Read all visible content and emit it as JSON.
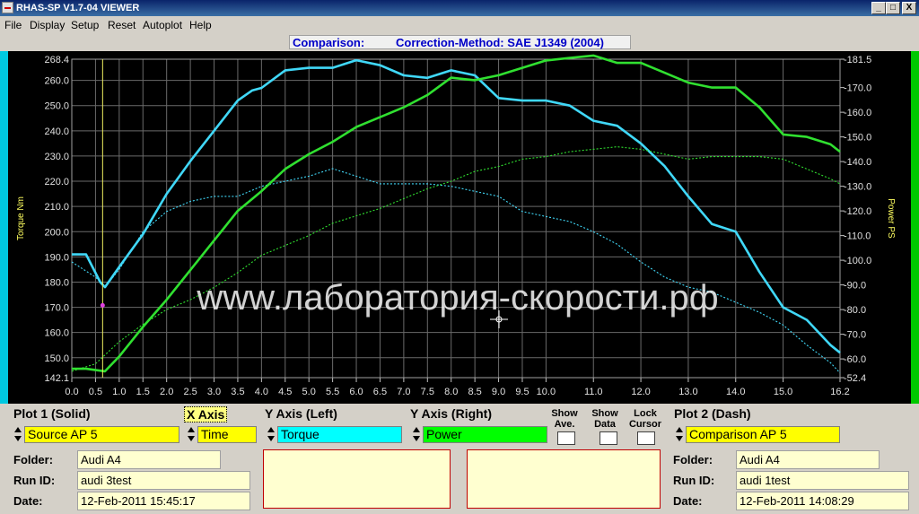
{
  "window": {
    "title": "RHAS-SP V1.7-04  VIEWER"
  },
  "window_buttons": [
    "_",
    "□",
    "X"
  ],
  "menu": [
    "File",
    "Display",
    "Setup",
    "Reset",
    "Autoplot",
    "Help"
  ],
  "status": {
    "label": "Comparison:",
    "method": "Correction-Method: SAE J1349 (2004)"
  },
  "watermark": "www.лаборатория-скорости.рф",
  "chart_data": {
    "type": "line",
    "xlim": [
      0,
      16.2
    ],
    "x_ticks": [
      "0.0",
      "0.5",
      "1.0",
      "1.5",
      "2.0",
      "2.5",
      "3.0",
      "3.5",
      "4.0",
      "4.5",
      "5.0",
      "5.5",
      "6.0",
      "6.5",
      "7.0",
      "7.5",
      "8.0",
      "8.5",
      "9.0",
      "9.5",
      "10.0",
      "11.0",
      "12.0",
      "13.0",
      "14.0",
      "15.0",
      "16.2"
    ],
    "ylabel_left": "Torque Nm",
    "ylim_left": [
      142.1,
      268.4
    ],
    "y_ticks_left": [
      "268.4",
      "260.0",
      "250.0",
      "240.0",
      "230.0",
      "220.0",
      "210.0",
      "200.0",
      "190.0",
      "180.0",
      "170.0",
      "160.0",
      "150.0",
      "142.1"
    ],
    "ylabel_right": "Power PS",
    "ylim_right": [
      52.4,
      181.5
    ],
    "y_ticks_right": [
      "181.5",
      "170.0",
      "160.0",
      "150.0",
      "140.0",
      "130.0",
      "120.0",
      "110.0",
      "100.0",
      "90.0",
      "80.0",
      "70.0",
      "60.0",
      "52.4"
    ],
    "cursor_x": 0.65,
    "series": [
      {
        "name": "Torque",
        "axis": "left",
        "style": "solid",
        "color": "#40d8f8",
        "x": [
          0,
          0.3,
          0.6,
          0.7,
          1.0,
          1.5,
          2.0,
          2.5,
          3.0,
          3.5,
          3.8,
          4.0,
          4.5,
          5.0,
          5.5,
          6.0,
          6.5,
          7.0,
          7.5,
          8.0,
          8.5,
          9.0,
          9.5,
          10.0,
          10.5,
          11.0,
          11.5,
          12.0,
          12.5,
          13.0,
          13.5,
          14.0,
          14.5,
          15.0,
          15.5,
          16.0,
          16.2
        ],
        "y": [
          191,
          191,
          180,
          178,
          186,
          199,
          215,
          228,
          240,
          252,
          256,
          257,
          264,
          265,
          265,
          268,
          266,
          262,
          261,
          264,
          262,
          253,
          252,
          252,
          250,
          244,
          242,
          235,
          226,
          214,
          203,
          200,
          184,
          170,
          165,
          155,
          152
        ]
      },
      {
        "name": "Torque (Comparison AP 5)",
        "axis": "left",
        "style": "dash",
        "color": "#40d8f8",
        "x": [
          0,
          0.5,
          0.7,
          1.0,
          1.5,
          2.0,
          2.5,
          3.0,
          3.5,
          4.0,
          4.5,
          5.0,
          5.5,
          6.0,
          6.5,
          7.0,
          7.5,
          8.0,
          8.5,
          9.0,
          9.5,
          10.0,
          10.5,
          11.0,
          11.5,
          12.0,
          12.5,
          13.0,
          13.5,
          14.0,
          14.5,
          15.0,
          15.5,
          16.0,
          16.2
        ],
        "y": [
          188,
          182,
          178,
          185,
          200,
          208,
          212,
          214,
          214,
          218,
          220,
          222,
          225,
          222,
          219,
          219,
          219,
          218,
          216,
          214,
          208,
          206,
          204,
          200,
          195,
          188,
          182,
          178,
          176,
          172,
          168,
          163,
          155,
          148,
          144
        ]
      },
      {
        "name": "Power",
        "axis": "right",
        "style": "solid",
        "color": "#30e030",
        "x": [
          0,
          0.3,
          0.7,
          1.0,
          1.5,
          2.0,
          2.5,
          3.0,
          3.5,
          4.0,
          4.5,
          5.0,
          5.5,
          6.0,
          6.5,
          7.0,
          7.5,
          8.0,
          8.5,
          9.0,
          9.5,
          10.0,
          10.5,
          11.0,
          11.5,
          12.0,
          12.5,
          13.0,
          13.5,
          14.0,
          14.5,
          15.0,
          15.5,
          16.0,
          16.2
        ],
        "y": [
          56,
          56,
          55,
          61,
          73,
          84,
          96,
          108,
          120,
          128,
          137,
          143,
          148,
          154,
          158,
          162,
          167,
          174,
          173,
          175,
          178,
          181,
          182,
          183,
          180,
          180,
          176,
          172,
          170,
          170,
          162,
          151,
          150,
          147,
          144
        ]
      },
      {
        "name": "Power (Comparison AP 5)",
        "axis": "right",
        "style": "dash",
        "color": "#30e030",
        "x": [
          0,
          0.5,
          1.0,
          1.5,
          2.0,
          2.5,
          3.0,
          3.5,
          4.0,
          4.5,
          5.0,
          5.5,
          6.0,
          6.5,
          7.0,
          7.5,
          8.0,
          8.5,
          9.0,
          9.5,
          10.0,
          10.5,
          11.0,
          11.5,
          12.0,
          12.5,
          13.0,
          13.5,
          14.0,
          14.5,
          15.0,
          15.5,
          16.0,
          16.2
        ],
        "y": [
          55,
          58,
          67,
          74,
          80,
          84,
          89,
          95,
          102,
          106,
          110,
          115,
          118,
          121,
          125,
          129,
          132,
          136,
          138,
          141,
          142,
          144,
          145,
          146,
          145,
          143,
          141,
          142,
          142,
          142,
          141,
          137,
          133,
          131
        ]
      }
    ]
  },
  "controls": {
    "plot1": {
      "label": "Plot 1 (Solid)",
      "value": "Source AP 5",
      "color": "#ffff00"
    },
    "xaxis": {
      "label": "X Axis",
      "value": "Time",
      "color": "#ffff00"
    },
    "yleft": {
      "label": "Y Axis (Left)",
      "value": "Torque",
      "color": "#00ffff"
    },
    "yright": {
      "label": "Y Axis (Right)",
      "value": "Power",
      "color": "#00ff00"
    },
    "show_ave": "Show Ave.",
    "show_data": "Show Data",
    "lock_cursor": "Lock Cursor",
    "plot2": {
      "label": "Plot 2 (Dash)",
      "value": "Comparison AP 5",
      "color": "#ffff00"
    }
  },
  "info_left": {
    "folder_label": "Folder:",
    "folder": "Audi A4",
    "run_label": "Run ID:",
    "run": "audi 3test",
    "date_label": "Date:",
    "date": "12-Feb-2011  15:45:17"
  },
  "info_right": {
    "folder_label": "Folder:",
    "folder": "Audi A4",
    "run_label": "Run ID:",
    "run": "audi 1test",
    "date_label": "Date:",
    "date": "12-Feb-2011  14:08:29"
  }
}
